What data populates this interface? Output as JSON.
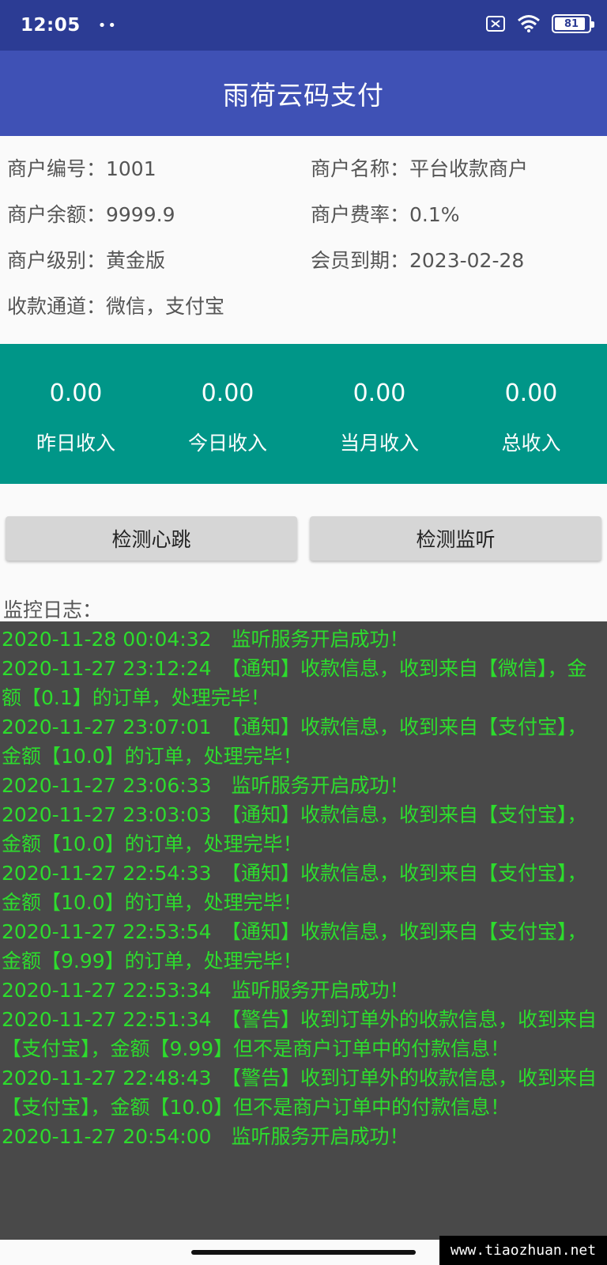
{
  "status_bar": {
    "time": "12:05",
    "dots": "••",
    "battery": "81",
    "icons": [
      "sim-off-icon",
      "wifi-icon",
      "battery-icon"
    ]
  },
  "app_bar": {
    "title": "雨荷云码支付"
  },
  "merchant": {
    "id": "商户编号：1001",
    "name": "商户名称：平台收款商户",
    "balance": "商户余额：9999.9",
    "rate": "商户费率：0.1%",
    "level": "商户级别：黄金版",
    "expiry": "会员到期：2023-02-28",
    "channels": "收款通道：微信，支付宝"
  },
  "stats": [
    {
      "value": "0.00",
      "label": "昨日收入"
    },
    {
      "value": "0.00",
      "label": "今日收入"
    },
    {
      "value": "0.00",
      "label": "当月收入"
    },
    {
      "value": "0.00",
      "label": "总收入"
    }
  ],
  "buttons": {
    "heartbeat": "检测心跳",
    "listen": "检测监听"
  },
  "log": {
    "label": "监控日志：",
    "lines": [
      "2020-11-28 00:04:32　监听服务开启成功！",
      "2020-11-27 23:12:24　【通知】收款信息，收到来自【微信】，金额【0.1】的订单，处理完毕！",
      "2020-11-27 23:07:01　【通知】收款信息，收到来自【支付宝】，金额【10.0】的订单，处理完毕！",
      "2020-11-27 23:06:33　监听服务开启成功！",
      "2020-11-27 23:03:03　【通知】收款信息，收到来自【支付宝】，金额【10.0】的订单，处理完毕！",
      "2020-11-27 22:54:33　【通知】收款信息，收到来自【支付宝】，金额【10.0】的订单，处理完毕！",
      "2020-11-27 22:53:54　【通知】收款信息，收到来自【支付宝】，金额【9.99】的订单，处理完毕！",
      "2020-11-27 22:53:34　监听服务开启成功！",
      "2020-11-27 22:51:34　【警告】收到订单外的收款信息，收到来自【支付宝】，金额【9.99】但不是商户订单中的付款信息！",
      "2020-11-27 22:48:43　【警告】收到订单外的收款信息，收到来自【支付宝】，金额【10.0】但不是商户订单中的付款信息！",
      "2020-11-27 20:54:00　监听服务开启成功！"
    ]
  },
  "watermark": "www.tiaozhuan.net",
  "colors": {
    "status_bar": "#2c3c94",
    "app_bar": "#3f51b5",
    "stats_bg": "#009688",
    "log_bg": "#494949",
    "log_text": "#2ddc2d"
  }
}
